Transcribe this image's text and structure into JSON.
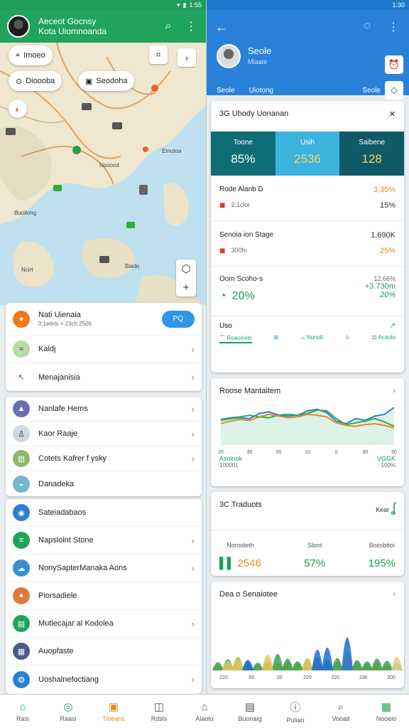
{
  "left": {
    "status_time": "1:55",
    "title_line1": "Aeceot Gocnsy",
    "title_line2": "Kota Uiomnoanda",
    "chips": {
      "search": "Imoeo",
      "filter1": "Dioooba",
      "filter2": "Seodoha"
    },
    "map_labels": [
      "Nooocd",
      "Emotoa",
      "Buoilong",
      "Biado",
      "Ncirt"
    ],
    "top_card": {
      "title": "Nati Uienaia",
      "subtitle": "0:1e6rls > 23ch 2506",
      "pill": "PQ",
      "rows": [
        "Kaldj",
        "Menajanisia"
      ]
    },
    "list2": [
      "Nanlafe Hems",
      "Kaor Raaje",
      "Cotets Kafrer f ysky",
      "Danadeka"
    ],
    "list3": [
      "Sateiadabaos",
      "Napsloint Stone",
      "NonySapterManaka  Aons",
      "Piorsadiele",
      "Mutlecajar al Kodolea",
      "Auopfaste",
      "Uoshalnefoctiang"
    ]
  },
  "right": {
    "status_time": "1:30",
    "name": "Seole",
    "sub": "Mlaate",
    "tab_left": "Seole",
    "tab_mid": "Uiotong",
    "tab_right": "Seole",
    "summary": {
      "title": "3G Uhody Uonanan",
      "stats": [
        {
          "label": "Toone",
          "value": "85%"
        },
        {
          "label": "Usih",
          "value": "2536"
        },
        {
          "label": "Saibene",
          "value": "128"
        }
      ],
      "metrics": [
        {
          "name": "Rode Alanb D",
          "sub": "2.1cloi",
          "val": "3,35%",
          "pct": "15%"
        },
        {
          "name": "Senoia ion Stage",
          "sub": "300fn",
          "val": "1.690K",
          "pct": "25%"
        },
        {
          "name": "Oom Scoho-s",
          "sub": "20%",
          "val": "12,66%",
          "val2": "+3.730m",
          "pct": "20%"
        }
      ],
      "footer_label": "Uso",
      "mini_icons": [
        "Roaoicelo",
        "",
        "Nunotl",
        "",
        "Acaolo"
      ]
    },
    "chart_card": {
      "title": "Roose Mantaitem",
      "ticks": [
        "20",
        "30",
        "30",
        "10",
        "0",
        "30",
        "50"
      ],
      "legend_left": "Asoinok",
      "legend_left_sub": "100001",
      "legend_right": "VGGK",
      "legend_right_sub": "100%"
    },
    "trade_card": {
      "title": "3C Traduots",
      "side": "Kear",
      "cols": [
        {
          "label": "Nonsdeth",
          "value": "2546"
        },
        {
          "label": "Slont",
          "value": "57%"
        },
        {
          "label": "Boiisbtioi",
          "value": "195%"
        }
      ]
    },
    "bar_card": {
      "title": "Dea o Senaiotee",
      "ticks": [
        "220",
        "60",
        "20",
        "220",
        "220",
        "230",
        "200"
      ]
    }
  },
  "colors": {
    "green": "#21a45d",
    "blue": "#2a82d8",
    "teal_dark": "#0f6d78",
    "teal_light": "#3bb3dd",
    "orange": "#e48a22"
  },
  "nav": [
    "Rasi",
    "Raasi",
    "Tioeans",
    "Rdsls",
    "Alaoto",
    "Buonaig",
    "Pulian",
    "Vooalt",
    "Nooeio"
  ],
  "chart_data": [
    {
      "type": "line",
      "title": "Roose Mantaitem",
      "categories": [
        "20",
        "30",
        "30",
        "10",
        "0",
        "30",
        "50"
      ],
      "series": [
        {
          "values": [
            58,
            62,
            64,
            62,
            74,
            78,
            70,
            68,
            70,
            80,
            84,
            76,
            56,
            50,
            62,
            58,
            68,
            72,
            88
          ]
        },
        {
          "values": [
            60,
            64,
            66,
            70,
            66,
            64,
            70,
            72,
            70,
            74,
            82,
            80,
            62,
            48,
            52,
            56,
            62,
            54,
            44
          ]
        },
        {
          "values": [
            50,
            56,
            60,
            58,
            66,
            72,
            68,
            64,
            66,
            72,
            70,
            66,
            52,
            46,
            44,
            48,
            50,
            46,
            40
          ]
        }
      ],
      "ylim": [
        0,
        100
      ]
    },
    {
      "type": "area",
      "title": "Dea o Senaiotee",
      "categories": [
        "220",
        "60",
        "20",
        "220",
        "220",
        "230",
        "200"
      ],
      "series": [
        {
          "values": [
            10,
            14,
            12,
            18,
            14,
            12,
            16,
            22,
            18,
            14,
            20,
            26,
            20,
            18,
            16,
            14,
            18,
            12,
            10
          ]
        },
        {
          "values": [
            18,
            26,
            32,
            22,
            16,
            22,
            42,
            28,
            20,
            26,
            32,
            22,
            30,
            40,
            24,
            20,
            28,
            22,
            16
          ]
        },
        {
          "values": [
            0,
            20,
            30,
            0,
            0,
            40,
            0,
            0,
            0,
            30,
            0,
            0,
            0,
            50,
            0,
            0,
            0,
            0,
            0
          ]
        },
        {
          "values": [
            0,
            0,
            0,
            24,
            0,
            0,
            0,
            0,
            0,
            0,
            54,
            60,
            0,
            90,
            0,
            0,
            0,
            0,
            0
          ]
        },
        {
          "values": [
            0,
            0,
            0,
            0,
            0,
            0,
            0,
            0,
            0,
            0,
            0,
            0,
            0,
            0,
            0,
            0,
            0,
            0,
            34
          ]
        }
      ],
      "ylim": [
        0,
        100
      ]
    }
  ]
}
